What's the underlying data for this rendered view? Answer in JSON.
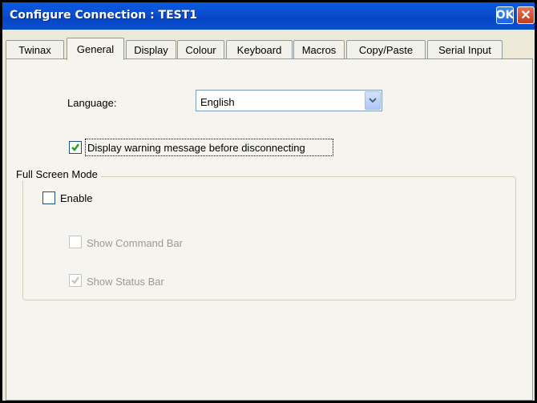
{
  "window": {
    "title": "Configure Connection : TEST1",
    "ok_label": "OK",
    "close_label": "✕"
  },
  "tabs": [
    {
      "label": "Twinax"
    },
    {
      "label": "General"
    },
    {
      "label": "Display"
    },
    {
      "label": "Colour"
    },
    {
      "label": "Keyboard"
    },
    {
      "label": "Macros"
    },
    {
      "label": "Copy/Paste"
    },
    {
      "label": "Serial Input"
    }
  ],
  "active_tab": "General",
  "general": {
    "language_label": "Language:",
    "language_value": "English",
    "warn_disconnect": {
      "label": "Display warning message before disconnecting",
      "checked": true
    },
    "full_screen": {
      "group_title": "Full Screen Mode",
      "enable": {
        "label": "Enable",
        "checked": false
      },
      "show_command_bar": {
        "label": "Show Command Bar",
        "checked": false,
        "enabled": false
      },
      "show_status_bar": {
        "label": "Show Status Bar",
        "checked": true,
        "enabled": false
      }
    }
  },
  "colors": {
    "titlebar": "#0a4fd0",
    "check_mark": "#21a121",
    "disabled_text": "#9a9a9a"
  }
}
